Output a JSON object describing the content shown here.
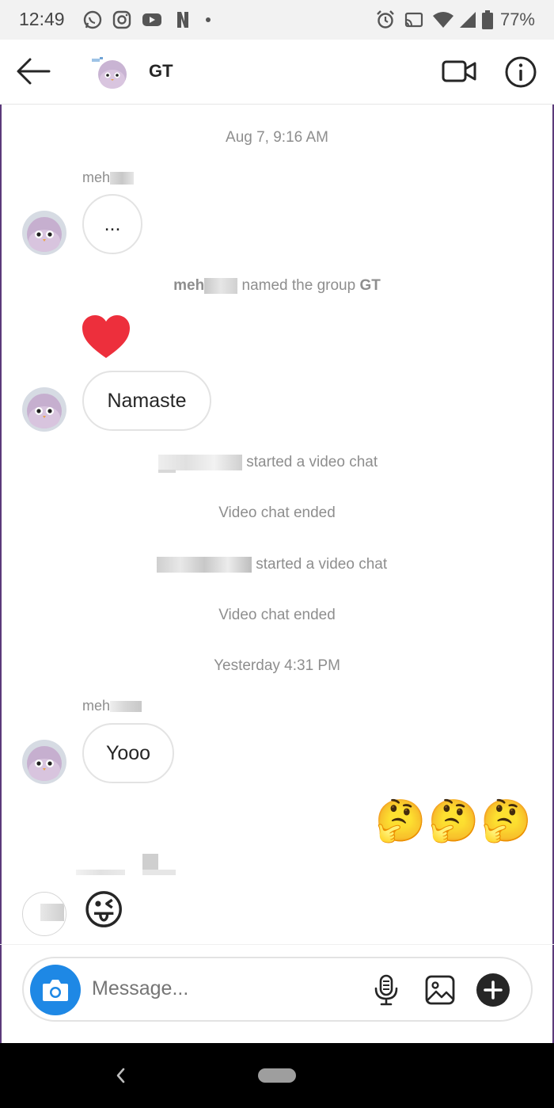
{
  "status_bar": {
    "time": "12:49",
    "battery": "77%",
    "icons": [
      "whatsapp-icon",
      "instagram-icon",
      "youtube-icon",
      "netflix-icon",
      "dot-icon",
      "alarm-icon",
      "cast-icon",
      "wifi-icon",
      "signal-icon",
      "battery-icon"
    ]
  },
  "header": {
    "title": "GT",
    "back_icon": "arrow-left-icon",
    "video_icon": "video-camera-icon",
    "info_icon": "info-icon"
  },
  "messages": {
    "ts1": "Aug 7, 9:16 AM",
    "sender1": "meh",
    "bubble1": "...",
    "system1_name": "meh",
    "system1_text": "named the group",
    "system1_group": "GT",
    "heart": "❤️",
    "bubble2": "Namaste",
    "system2_text": "started a video chat",
    "system3_text": "Video chat ended",
    "system4_text": "started a video chat",
    "system5_text": "Video chat ended",
    "ts2": "Yesterday 4:31 PM",
    "sender2": "meh",
    "bubble3": "Yooo",
    "own_emojis": "🤔🤔🤔",
    "last_emoji": "😜"
  },
  "composer": {
    "placeholder": "Message...",
    "camera_icon": "camera-icon",
    "mic_icon": "microphone-icon",
    "gallery_icon": "image-icon",
    "add_icon": "plus-icon"
  },
  "colors": {
    "accent": "#1e88e5",
    "heart": "#ed2f3c",
    "muted": "#8e8e8e"
  }
}
